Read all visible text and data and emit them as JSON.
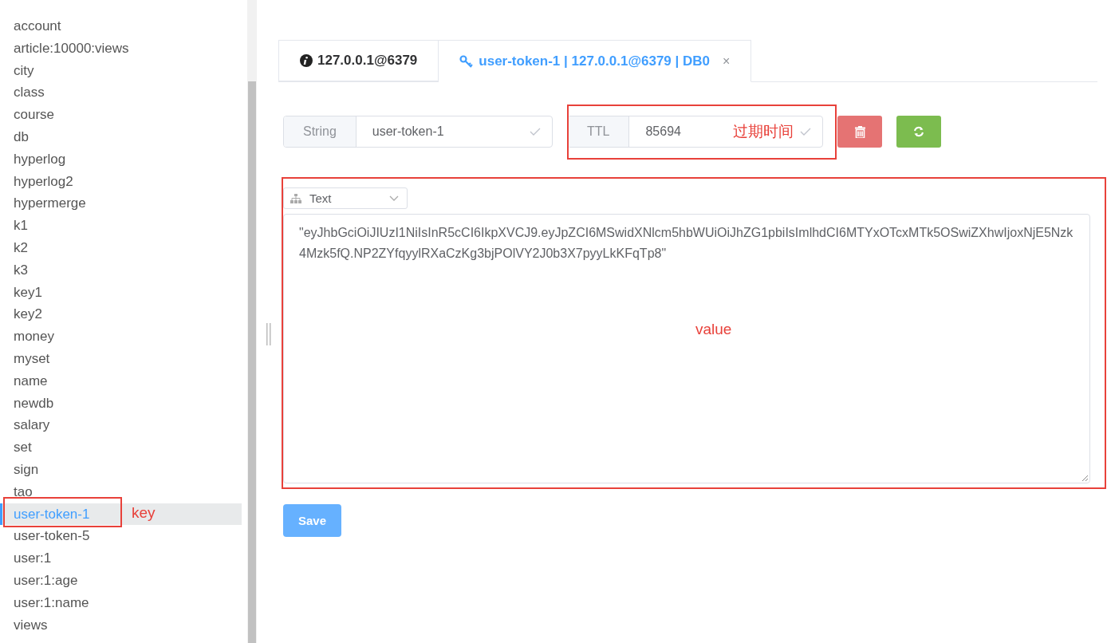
{
  "sidebar": {
    "keys": [
      {
        "label": "account",
        "selected": false
      },
      {
        "label": "article:10000:views",
        "selected": false
      },
      {
        "label": "city",
        "selected": false
      },
      {
        "label": "class",
        "selected": false
      },
      {
        "label": "course",
        "selected": false
      },
      {
        "label": "db",
        "selected": false
      },
      {
        "label": "hyperlog",
        "selected": false
      },
      {
        "label": "hyperlog2",
        "selected": false
      },
      {
        "label": "hypermerge",
        "selected": false
      },
      {
        "label": "k1",
        "selected": false
      },
      {
        "label": "k2",
        "selected": false
      },
      {
        "label": "k3",
        "selected": false
      },
      {
        "label": "key1",
        "selected": false
      },
      {
        "label": "key2",
        "selected": false
      },
      {
        "label": "money",
        "selected": false
      },
      {
        "label": "myset",
        "selected": false
      },
      {
        "label": "name",
        "selected": false
      },
      {
        "label": "newdb",
        "selected": false
      },
      {
        "label": "salary",
        "selected": false
      },
      {
        "label": "set",
        "selected": false
      },
      {
        "label": "sign",
        "selected": false
      },
      {
        "label": "tao",
        "selected": false
      },
      {
        "label": "user-token-1",
        "selected": true
      },
      {
        "label": "user-token-5",
        "selected": false
      },
      {
        "label": "user:1",
        "selected": false
      },
      {
        "label": "user:1:age",
        "selected": false
      },
      {
        "label": "user:1:name",
        "selected": false
      },
      {
        "label": "views",
        "selected": false
      }
    ],
    "annotation": "key"
  },
  "tabs": [
    {
      "label": "127.0.0.1@6379",
      "kind": "info",
      "selected": false
    },
    {
      "label": "user-token-1 | 127.0.0.1@6379 | DB0",
      "kind": "key",
      "selected": true,
      "close": "×"
    }
  ],
  "key_bar": {
    "type": "String",
    "key_name": "user-token-1",
    "ttl_label": "TTL",
    "ttl_value": "85694",
    "ttl_annotation": "过期时间"
  },
  "value_editor": {
    "format": "Text",
    "value": "\"eyJhbGciOiJIUzI1NiIsInR5cCI6IkpXVCJ9.eyJpZCI6MSwidXNlcm5hbWUiOiJhZG1pbiIsImlhdCI6MTYxOTcxMTk5OSwiZXhwIjoxNjE5Nzk4Mzk5fQ.NP2ZYfqyylRXaCzKg3bjPOlVY2J0b3X7pyyLkKFqTp8\"",
    "annotation": "value"
  },
  "save_button": "Save"
}
